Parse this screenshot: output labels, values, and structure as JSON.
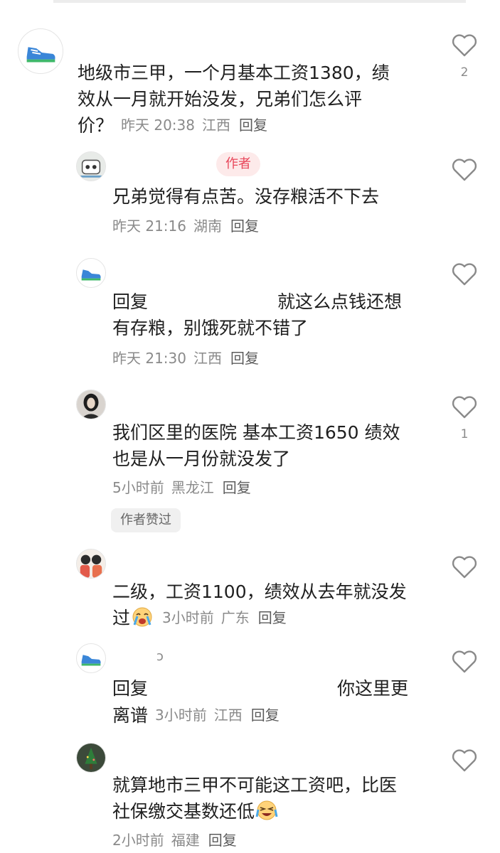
{
  "comments": [
    {
      "lines": [
        "地级市三甲，一个月基本工资1380，绩",
        "效从一月就开始没发，兄弟们怎么评"
      ],
      "last_line": "价？",
      "time": "昨天 20:38",
      "location": "江西",
      "reply_label": "回复",
      "likes": "2",
      "avatar_icon": "sneaker-avatar-icon"
    },
    {
      "badge": "作者",
      "lines": [
        "兄弟觉得有点苦。没存粮活不下去"
      ],
      "time": "昨天 21:16",
      "location": "湖南",
      "reply_label": "回复",
      "likes": "",
      "avatar_icon": "cartoon-avatar-icon"
    },
    {
      "reply_prefix": "回复",
      "reply_text": "就这么点钱还想",
      "lines": [
        "有存粮，别饿死就不错了"
      ],
      "time": "昨天 21:30",
      "location": "江西",
      "reply_label": "回复",
      "likes": "",
      "avatar_icon": "sneaker-avatar-icon"
    },
    {
      "lines": [
        "我们区里的医院 基本工资1650 绩效",
        "也是从一月份就没发了"
      ],
      "time": "5小时前",
      "location": "黑龙江",
      "reply_label": "回复",
      "likes": "1",
      "badge": "作者赞过",
      "avatar_icon": "person-avatar-icon"
    },
    {
      "lines": [
        "二级，工资1100，绩效从去年就没发"
      ],
      "last_line": "过",
      "emoji": "crying-face-emoji",
      "time": "3小时前",
      "location": "广东",
      "reply_label": "回复",
      "likes": "",
      "avatar_icon": "people-avatar-icon"
    },
    {
      "nickname_stub": "ɔ",
      "reply_prefix": "回复",
      "reply_text": "你这里更",
      "last_line": "离谱",
      "time": "3小时前",
      "location": "江西",
      "reply_label": "回复",
      "likes": "",
      "avatar_icon": "sneaker-avatar-icon"
    },
    {
      "lines": [
        "就算地市三甲不可能这工资吧，比医"
      ],
      "last_line": "社保缴交基数还低",
      "emoji": "crying-laugh-emoji",
      "time": "2小时前",
      "location": "福建",
      "reply_label": "回复",
      "likes": "",
      "avatar_icon": "tree-avatar-icon"
    }
  ],
  "colors": {
    "accent": "#e8465a",
    "meta": "#8a8a8a",
    "text": "#1f1f1f"
  }
}
